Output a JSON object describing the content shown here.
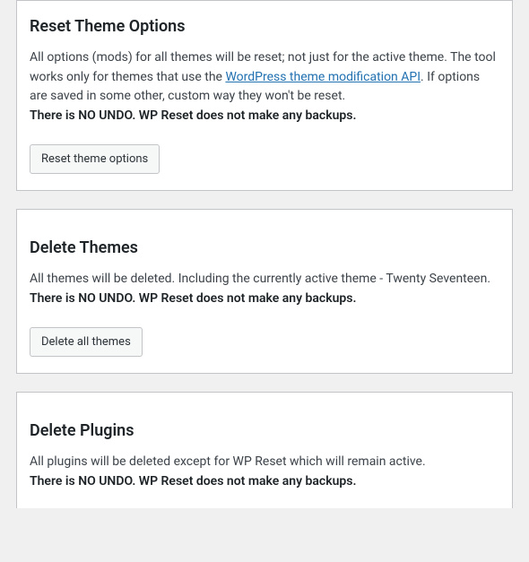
{
  "sections": {
    "resetThemeOptions": {
      "title": "Reset Theme Options",
      "desc_before": "All options (mods) for all themes will be reset; not just for the active theme. The tool works only for themes that use the ",
      "link_text": "WordPress theme modification API",
      "desc_after": ". If options are saved in some other, custom way they won't be reset.",
      "warning": "There is NO UNDO. WP Reset does not make any backups.",
      "button": "Reset theme options"
    },
    "deleteThemes": {
      "title": "Delete Themes",
      "desc": "All themes will be deleted. Including the currently active theme - Twenty Seventeen.",
      "warning": "There is NO UNDO. WP Reset does not make any backups.",
      "button": "Delete all themes"
    },
    "deletePlugins": {
      "title": "Delete Plugins",
      "desc": "All plugins will be deleted except for WP Reset which will remain active.",
      "warning": "There is NO UNDO. WP Reset does not make any backups."
    }
  }
}
